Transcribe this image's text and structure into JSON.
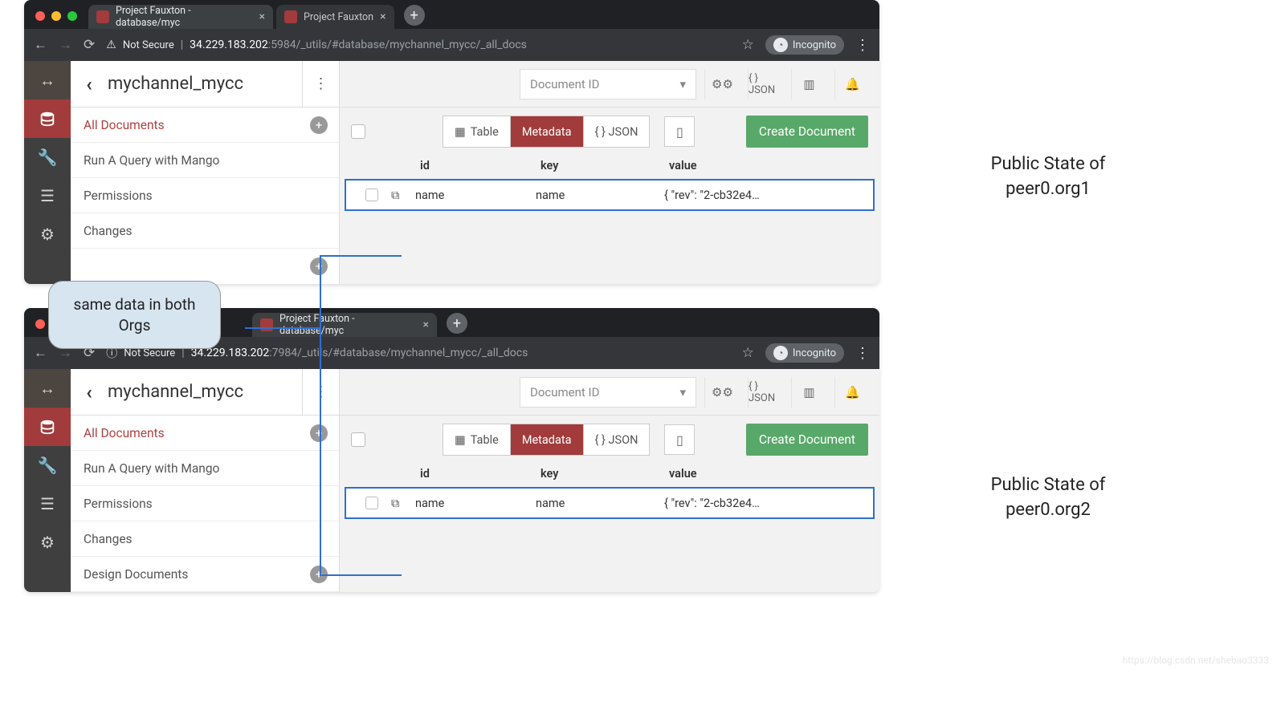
{
  "tabs": {
    "t1": "Project Fauxton - database/myc",
    "t2": "Project Fauxton",
    "t2b": "Project Fauxton - database/myc"
  },
  "addr": {
    "notsecure": "Not Secure",
    "host1": "34.229.183.202",
    "path1": ":5984/_utils/#database/mychannel_mycc/_all_docs",
    "host2": "34.229.183.202",
    "path2": ":7984/_utils/#database/mychannel_mycc/_all_docs",
    "incog": "Incognito"
  },
  "db": {
    "name": "mychannel_mycc"
  },
  "sidebar": {
    "alldocs": "All Documents",
    "mango": "Run A Query with Mango",
    "perm": "Permissions",
    "changes": "Changes",
    "design": "Design Documents"
  },
  "toolbar": {
    "docid": "Document ID",
    "json": "{ } JSON"
  },
  "view": {
    "table": "Table",
    "metadata": "Metadata",
    "json": "{ }  JSON",
    "create": "Create Document"
  },
  "cols": {
    "id": "id",
    "key": "key",
    "value": "value"
  },
  "row": {
    "id": "name",
    "key": "name",
    "value": "{ \"rev\": \"2-cb32e4…"
  },
  "ann": {
    "callout": "same data in both Orgs",
    "label1": "Public State of peer0.org1",
    "label2": "Public State of peer0.org2"
  },
  "watermark": "https://blog.csdn.net/shebao3333"
}
